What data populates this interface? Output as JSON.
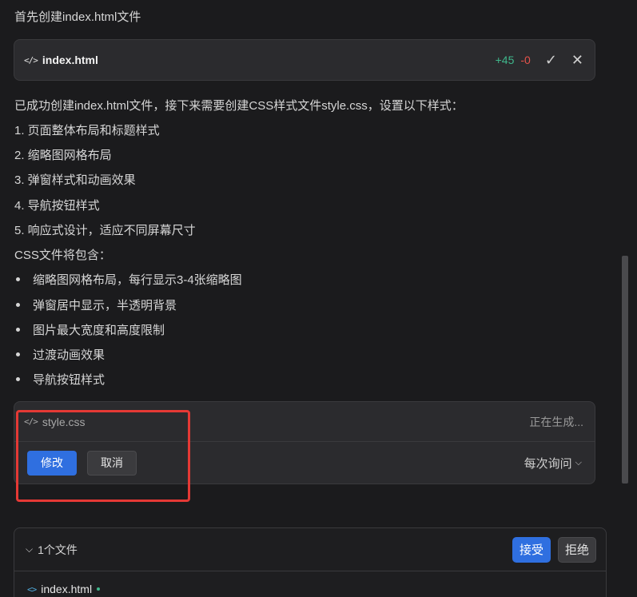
{
  "intro_text": "首先创建index.html文件",
  "file_card": {
    "icon": "code-icon",
    "file_name": "index.html",
    "additions": "+45",
    "deletions": "-0",
    "accept_symbol": "✓",
    "reject_symbol": "✕"
  },
  "message": "已成功创建index.html文件，接下来需要创建CSS样式文件style.css，设置以下样式：",
  "numbered_items": [
    "1. 页面整体布局和标题样式",
    "2. 缩略图网格布局",
    "3. 弹窗样式和动画效果",
    "4. 导航按钮样式",
    "5. 响应式设计，适应不同屏幕尺寸"
  ],
  "css_intro": "CSS文件将包含：",
  "bullet_items": [
    "缩略图网格布局，每行显示3-4张缩略图",
    "弹窗居中显示，半透明背景",
    "图片最大宽度和高度限制",
    "过渡动画效果",
    "导航按钮样式"
  ],
  "css_card": {
    "icon": "code-icon",
    "file_name": "style.css",
    "status": "正在生成...",
    "edit_label": "修改",
    "cancel_label": "取消",
    "ask_label": "每次询问"
  },
  "files_panel": {
    "count_label": "1个文件",
    "accept_label": "接受",
    "reject_label": "拒绝",
    "files": [
      {
        "name": "index.html"
      }
    ]
  },
  "colors": {
    "background": "#1b1b1d",
    "card": "#2b2b2e",
    "accent_blue": "#2f6fe0",
    "addition_green": "#3fb68b",
    "deletion_red": "#e5534b",
    "highlight_box": "#e53935"
  }
}
